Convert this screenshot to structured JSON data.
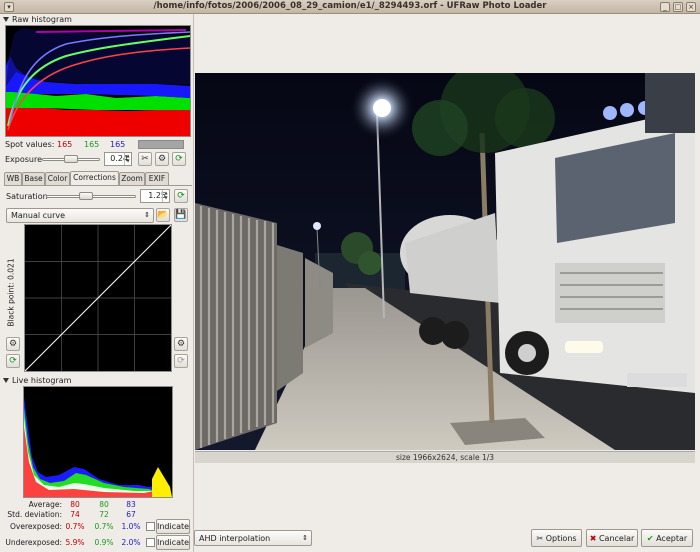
{
  "window": {
    "title": "/home/info/fotos/2006/2006_08_29_camion/e1/_8294493.orf - UFRaw Photo Loader"
  },
  "raw_histogram": {
    "label": "Raw histogram"
  },
  "spot": {
    "label": "Spot values:",
    "r": "165",
    "g": "165",
    "b": "165"
  },
  "exposure": {
    "label": "Exposure",
    "value": "0.24",
    "level": 0.55
  },
  "tabs": [
    "WB",
    "Base",
    "Color",
    "Corrections",
    "Zoom",
    "EXIF"
  ],
  "active_tab": "Corrections",
  "saturation": {
    "label": "Saturation",
    "value": "1.25",
    "level": 0.4
  },
  "curve": {
    "selected": "Manual curve",
    "black_point_label": "Black point: 0.021"
  },
  "live_histogram": {
    "label": "Live histogram"
  },
  "stats": {
    "average": {
      "label": "Average:",
      "r": "80",
      "g": "80",
      "b": "83"
    },
    "std": {
      "label": "Std. deviation:",
      "r": "74",
      "g": "72",
      "b": "67"
    },
    "over": {
      "label": "Overexposed:",
      "r": "0.7%",
      "g": "0.7%",
      "b": "1.0%",
      "button": "Indicate"
    },
    "under": {
      "label": "Underexposed:",
      "r": "5.9%",
      "g": "0.9%",
      "b": "2.0%",
      "button": "Indicate"
    }
  },
  "image": {
    "status": "size 1966x2624, scale 1/3"
  },
  "interpolation": {
    "selected": "AHD interpolation"
  },
  "buttons": {
    "options": "Options",
    "cancel": "Cancelar",
    "accept": "Aceptar"
  },
  "colors": {
    "red": "#c00000",
    "green": "#1a9a1a",
    "blue": "#2020c0",
    "window_bg": "#efebe7"
  },
  "icons": [
    "scissors-icon",
    "curve-icon",
    "refresh-icon",
    "folder-open-icon",
    "save-icon",
    "close-icon",
    "minimize-icon",
    "maximize-icon",
    "options-icon",
    "cancel-icon",
    "accept-icon"
  ]
}
